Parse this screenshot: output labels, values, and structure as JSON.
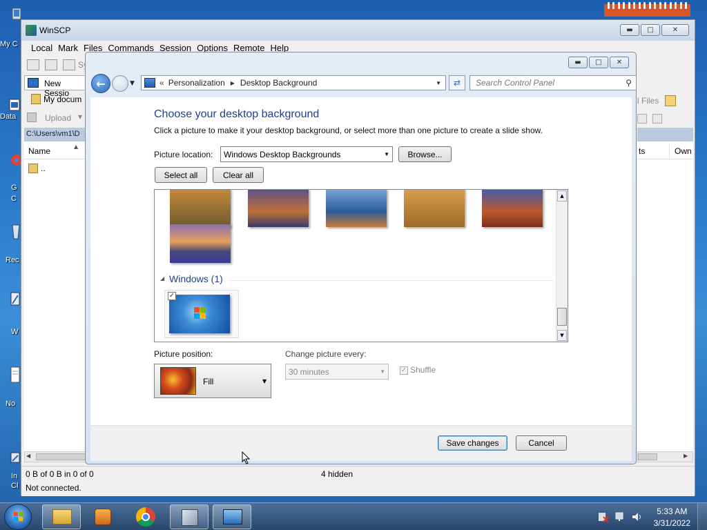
{
  "desktop": {
    "icons": [
      {
        "label": "My C",
        "name": "my-computer"
      },
      {
        "label": "Data",
        "name": "data"
      },
      {
        "label": "G",
        "name": "google-chrome"
      },
      {
        "label": "C",
        "name": "chrome-label-2"
      },
      {
        "label": "Rec",
        "name": "recycle-bin"
      },
      {
        "label": "W",
        "name": "w-app"
      },
      {
        "label": "No",
        "name": "notepad"
      },
      {
        "label": "In",
        "name": "internet"
      },
      {
        "label": "Cl",
        "name": "cl-app"
      }
    ]
  },
  "winscp": {
    "title": "WinSCP",
    "menu": [
      "Local",
      "Mark",
      "Files",
      "Commands",
      "Session",
      "Options",
      "Remote",
      "Help"
    ],
    "toolbar_sync": "Sy",
    "new_session": "New Sessio",
    "my_documents": "My docum",
    "upload": "Upload",
    "local_path": "C:\\Users\\vm1\\D",
    "col_name": "Name",
    "parent_dir": "..",
    "remote_files": "l Files",
    "remote_col_rights": "ts",
    "remote_col_owner": "Own",
    "status_bytes": "0 B of 0 B in 0 of 0",
    "status_hidden": "4 hidden",
    "status_connection": "Not connected."
  },
  "dialog": {
    "breadcrumb_prefix": "«",
    "breadcrumb": [
      "Personalization",
      "Desktop Background"
    ],
    "search_placeholder": "Search Control Panel",
    "heading": "Choose your desktop background",
    "description": "Click a picture to make it your desktop background, or select more than one picture to create a slide show.",
    "picture_location_label": "Picture location:",
    "picture_location_value": "Windows Desktop Backgrounds",
    "browse_label": "Browse...",
    "select_all_label": "Select all",
    "clear_all_label": "Clear all",
    "group_windows_label": "Windows (1)",
    "picture_position_label": "Picture position:",
    "picture_position_value": "Fill",
    "change_every_label": "Change picture every:",
    "change_every_value": "30 minutes",
    "shuffle_label": "Shuffle",
    "save_label": "Save changes",
    "cancel_label": "Cancel"
  },
  "taskbar": {
    "time": "5:33 AM",
    "date": "3/31/2022",
    "apps": [
      "windows-explorer",
      "media-player",
      "google-chrome",
      "winscp",
      "control-panel"
    ]
  }
}
